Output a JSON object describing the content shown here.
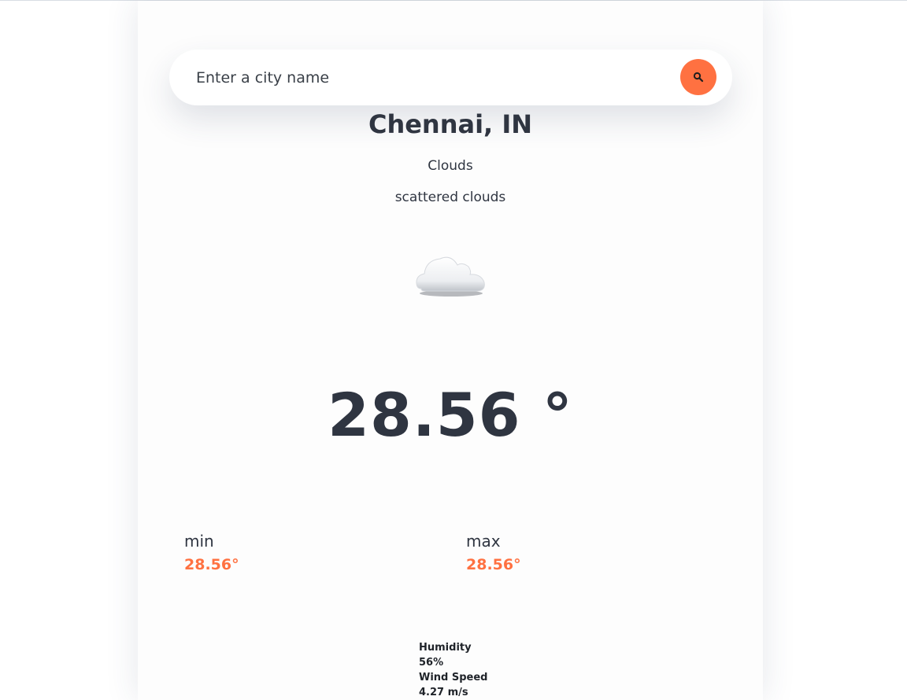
{
  "search": {
    "placeholder": "Enter a city name"
  },
  "location": {
    "city": "Chennai, IN"
  },
  "weather": {
    "main": "Clouds",
    "description": "scattered clouds",
    "icon": "cloud-icon"
  },
  "temperature": {
    "current": "28.56 °",
    "min_label": "min",
    "min_value": "28.56°",
    "max_label": "max",
    "max_value": "28.56°"
  },
  "details": {
    "humidity_label": "Humidity",
    "humidity_value": "56%",
    "wind_label": "Wind Speed",
    "wind_value": "4.27 m/s"
  },
  "colors": {
    "accent": "#ff7141",
    "text": "#2f3541",
    "background": "#ffffff"
  }
}
